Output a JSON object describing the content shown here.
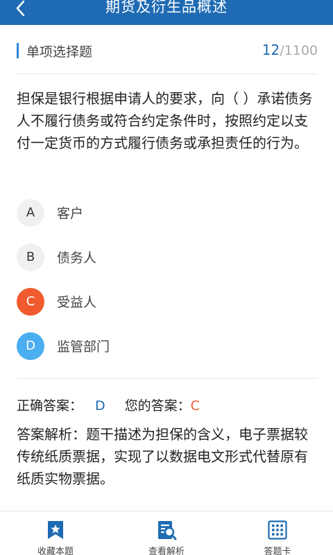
{
  "header": {
    "title": "期货及衍生品概述"
  },
  "question_type": "单项选择题",
  "counter": {
    "current": "12",
    "total": "/1100"
  },
  "question": "担保是银行根据申请人的要求，向（  ）承诺债务人不履行债务或符合约定条件时，按照约定以支付一定货币的方式履行债务或承担责任的行为。",
  "options": [
    {
      "letter": "A",
      "text": "客户",
      "state": "normal"
    },
    {
      "letter": "B",
      "text": "债务人",
      "state": "normal"
    },
    {
      "letter": "C",
      "text": "受益人",
      "state": "wrong"
    },
    {
      "letter": "D",
      "text": "监管部门",
      "state": "correct"
    }
  ],
  "answers": {
    "correct_label": "正确答案：",
    "correct_value": "D",
    "yours_label": "您的答案：",
    "yours_value": "C"
  },
  "analysis": "答案解析：题干描述为担保的含义，电子票据较传统纸质票据，实现了以数据电文形式代替原有纸质实物票据。",
  "bottom_tabs": [
    {
      "label": "收藏本题",
      "icon": "bookmark-star-icon"
    },
    {
      "label": "查看解析",
      "icon": "document-search-icon"
    },
    {
      "label": "答题卡",
      "icon": "answer-grid-icon"
    }
  ],
  "colors": {
    "primary": "#1f6bb3",
    "wrong": "#f05a2f",
    "correct": "#4aaef0",
    "neutral_circle": "#f0f0f0"
  }
}
